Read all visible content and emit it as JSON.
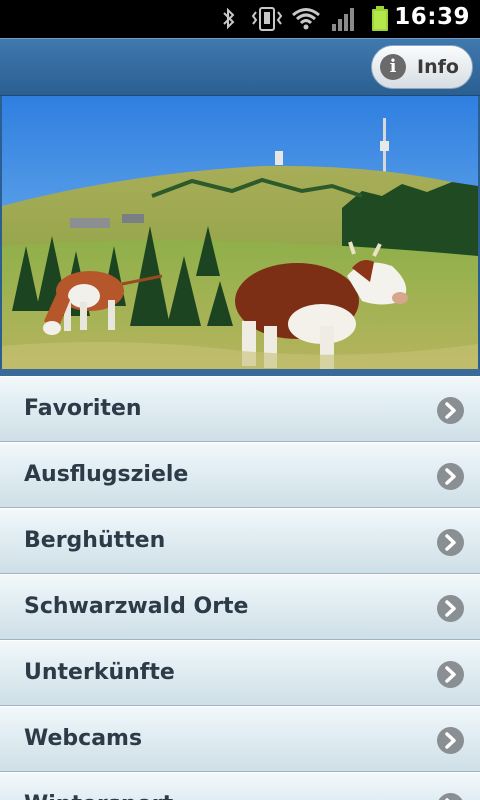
{
  "status_bar": {
    "time": "16:39",
    "icons": [
      "bluetooth-icon",
      "vibrate-icon",
      "wifi-icon",
      "signal-icon",
      "battery-icon"
    ]
  },
  "header": {
    "info_label": "Info",
    "info_icon_glyph": "i"
  },
  "hero": {
    "image": "feldberg-cows-meadow"
  },
  "menu": {
    "items": [
      {
        "label": "Favoriten"
      },
      {
        "label": "Ausflugsziele"
      },
      {
        "label": "Berghütten"
      },
      {
        "label": "Schwarzwald Orte"
      },
      {
        "label": "Unterkünfte"
      },
      {
        "label": "Webcams"
      },
      {
        "label": "Wintersport"
      }
    ]
  },
  "colors": {
    "header_blue": "#2f6699",
    "menu_text": "#2c3b47",
    "chevron_gray": "#8a8f93"
  }
}
